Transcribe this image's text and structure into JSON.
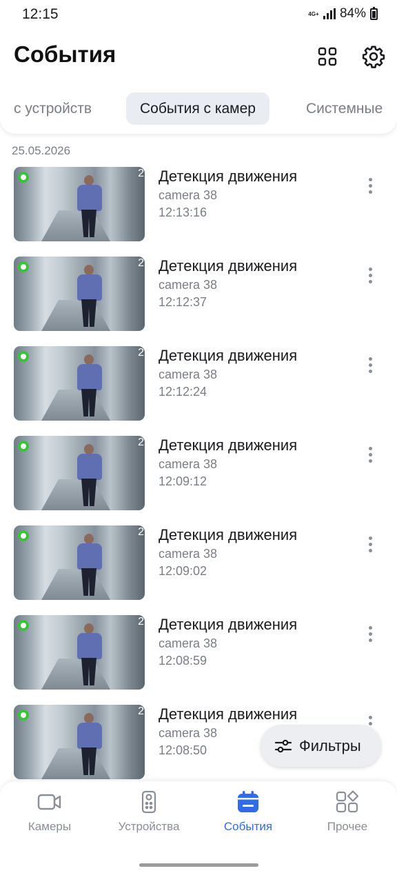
{
  "status_bar": {
    "time": "12:15",
    "network": "4G+",
    "battery": "84%"
  },
  "header": {
    "title": "События",
    "grid_icon": "grid-icon",
    "settings_icon": "gear-icon"
  },
  "tabs": [
    {
      "label": "с устройств",
      "active": false
    },
    {
      "label": "События с камер",
      "active": true
    },
    {
      "label": "Системные",
      "active": false
    }
  ],
  "date_header": "25.05.2026",
  "events": [
    {
      "title": "Детекция движения",
      "camera": "camera 38",
      "time": "12:13:16",
      "thumb_number": "2"
    },
    {
      "title": "Детекция движения",
      "camera": "camera 38",
      "time": "12:12:37",
      "thumb_number": "2"
    },
    {
      "title": "Детекция движения",
      "camera": "camera 38",
      "time": "12:12:24",
      "thumb_number": "2"
    },
    {
      "title": "Детекция движения",
      "camera": "camera 38",
      "time": "12:09:12",
      "thumb_number": "2"
    },
    {
      "title": "Детекция движения",
      "camera": "camera 38",
      "time": "12:09:02",
      "thumb_number": "2"
    },
    {
      "title": "Детекция движения",
      "camera": "camera 38",
      "time": "12:08:59",
      "thumb_number": "2"
    },
    {
      "title": "Детекция движения",
      "camera": "camera 38",
      "time": "12:08:50",
      "thumb_number": "2"
    }
  ],
  "filter_button": {
    "label": "Фильтры",
    "icon": "sliders-icon"
  },
  "bottom_nav": [
    {
      "label": "Камеры",
      "icon": "video-camera-icon",
      "active": false
    },
    {
      "label": "Устройства",
      "icon": "remote-icon",
      "active": false
    },
    {
      "label": "События",
      "icon": "calendar-icon",
      "active": true
    },
    {
      "label": "Прочее",
      "icon": "apps-icon",
      "active": false
    }
  ],
  "colors": {
    "accent": "#2f6ce5",
    "rec_indicator": "#38c438",
    "muted_text": "#7a7e86"
  }
}
